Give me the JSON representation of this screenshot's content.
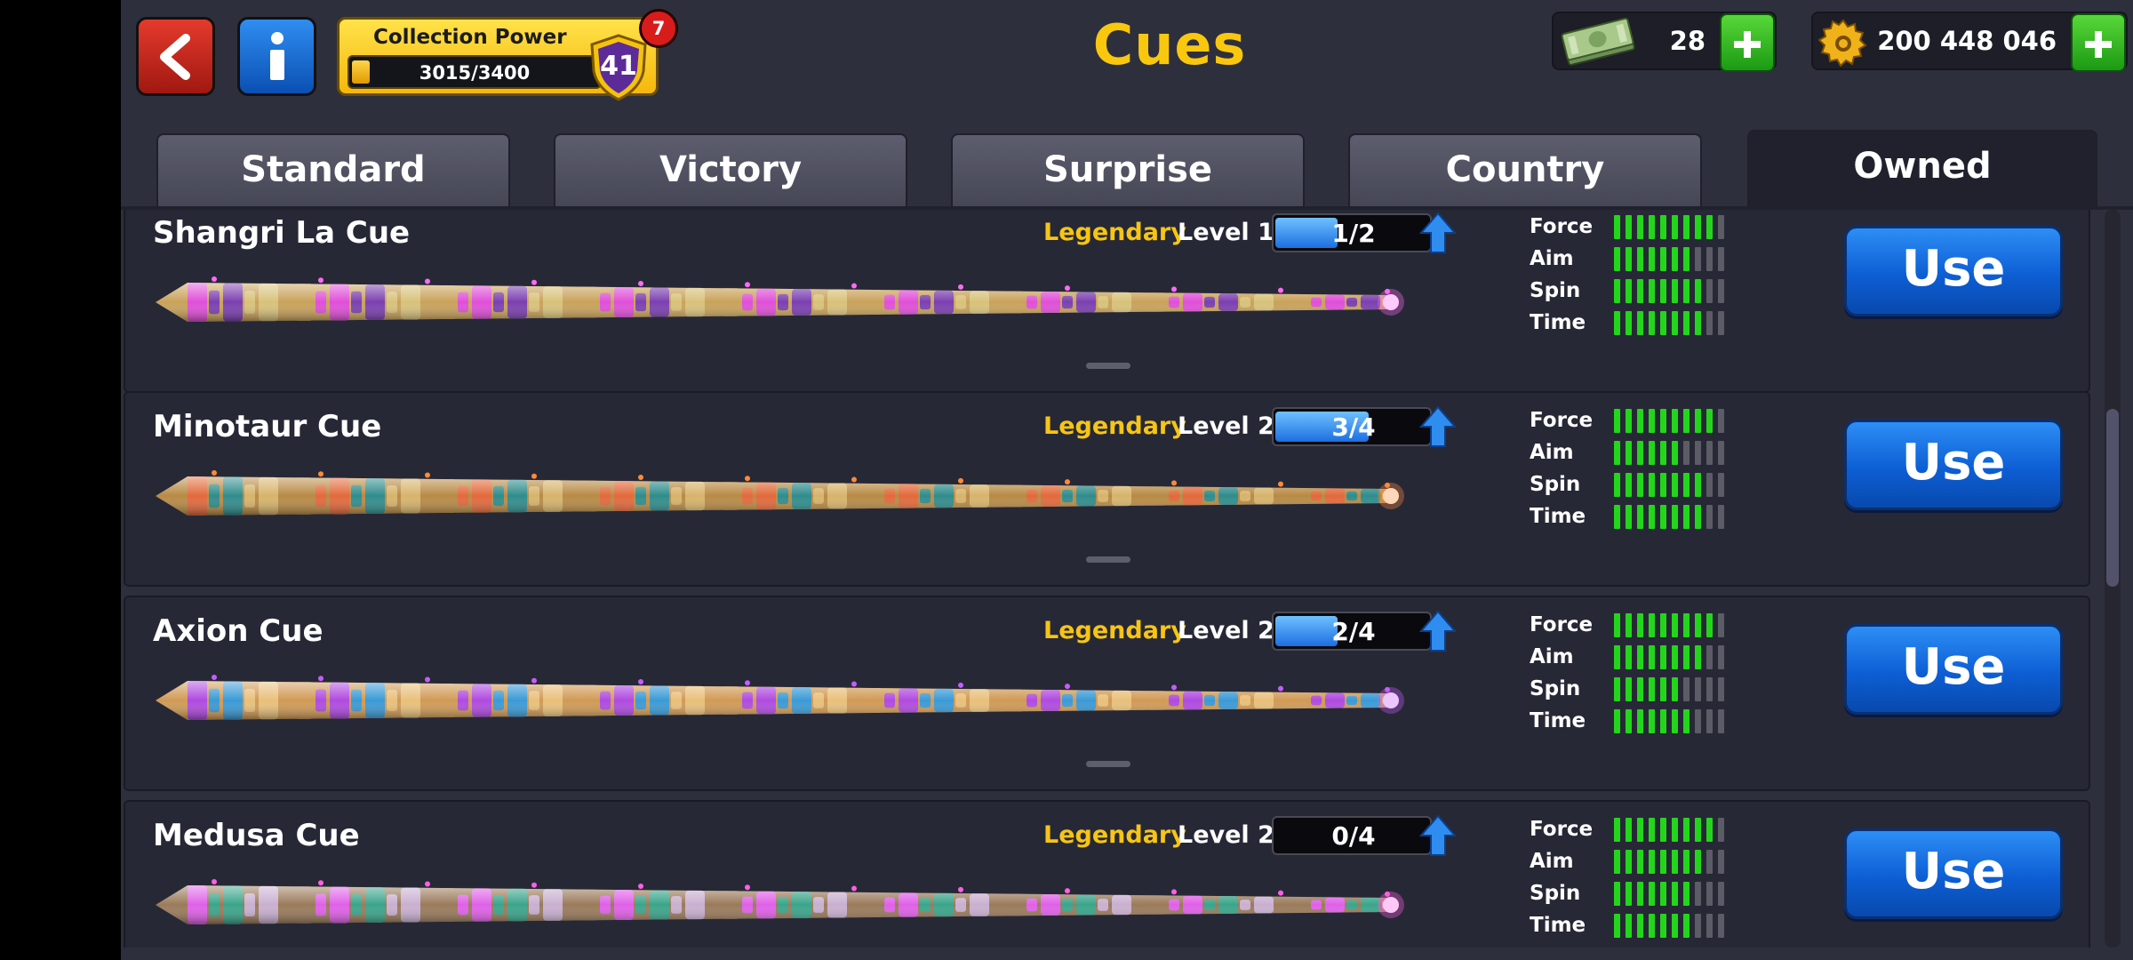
{
  "header": {
    "title": "Cues",
    "collection": {
      "label": "Collection Power",
      "progress_text": "3015/3400",
      "progress": 0.887,
      "level": "41",
      "notifications": "7"
    },
    "cash": "28",
    "coins": "200 448 046"
  },
  "tabs": [
    {
      "label": "Standard",
      "active": false
    },
    {
      "label": "Victory",
      "active": false
    },
    {
      "label": "Surprise",
      "active": false
    },
    {
      "label": "Country",
      "active": false
    },
    {
      "label": "Owned",
      "active": true
    }
  ],
  "stat_labels": [
    "Force",
    "Aim",
    "Spin",
    "Time"
  ],
  "use_label": "Use",
  "cues": [
    {
      "name": "Shangri La Cue",
      "rarity": "Legendary",
      "level": "Level 1",
      "progress_text": "1/2",
      "progress": 0.5,
      "stats": [
        9,
        7,
        8,
        8
      ],
      "theme": "pink"
    },
    {
      "name": "Minotaur Cue",
      "rarity": "Legendary",
      "level": "Level 2",
      "progress_text": "3/4",
      "progress": 0.75,
      "stats": [
        9,
        6,
        8,
        8
      ],
      "theme": "orange"
    },
    {
      "name": "Axion Cue",
      "rarity": "Legendary",
      "level": "Level 2",
      "progress_text": "2/4",
      "progress": 0.5,
      "stats": [
        9,
        8,
        6,
        7
      ],
      "theme": "violet"
    },
    {
      "name": "Medusa Cue",
      "rarity": "Legendary",
      "level": "Level 2",
      "progress_text": "0/4",
      "progress": 0,
      "stats": [
        9,
        8,
        7,
        7
      ],
      "theme": "magenta"
    }
  ],
  "colors": {
    "accent": "#f9c80e",
    "rarity": "#f6c515",
    "stat_on": "#23d61c",
    "use_button": "#0d5ed4"
  }
}
